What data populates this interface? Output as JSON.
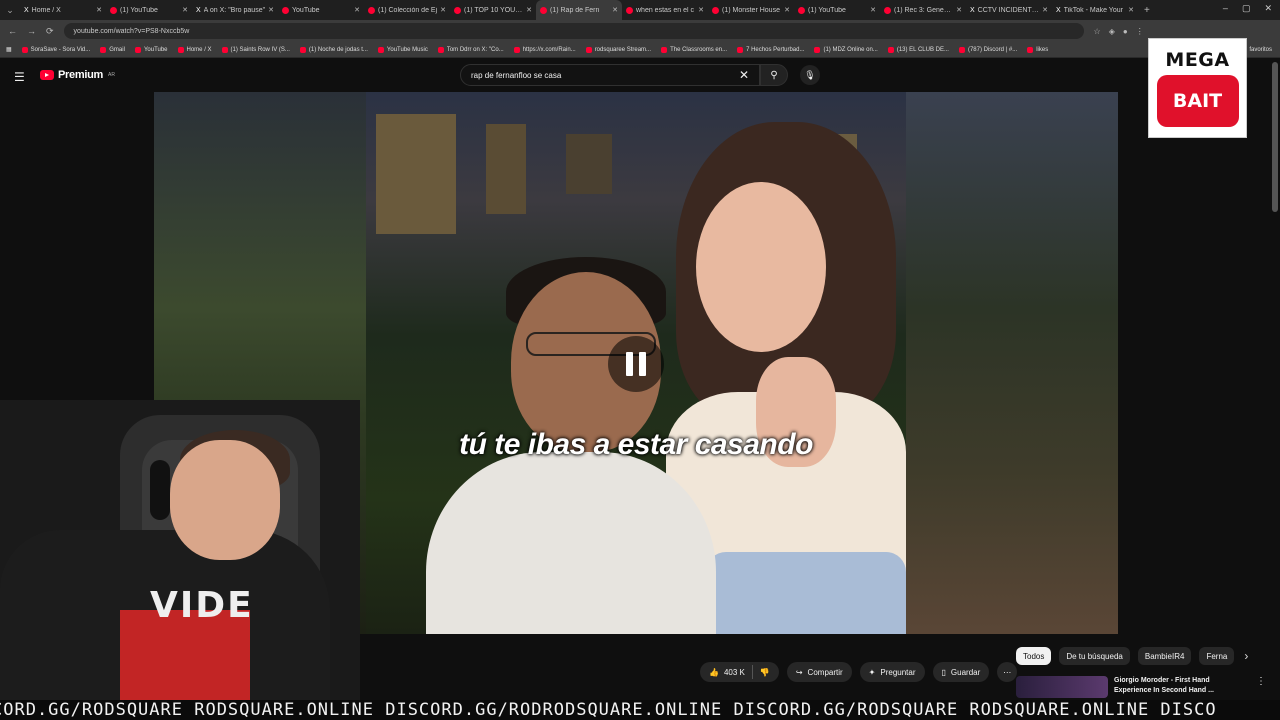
{
  "tabs": [
    {
      "title": "Home / X",
      "icon": "x"
    },
    {
      "title": "(1) YouTube",
      "icon": "yt"
    },
    {
      "title": "A on X: \"Bro pause\"",
      "icon": "x"
    },
    {
      "title": "YouTube",
      "icon": "yt"
    },
    {
      "title": "(1) Colección de Ej",
      "icon": "yt"
    },
    {
      "title": "(1) TOP 10 YOUTUB",
      "icon": "yt"
    },
    {
      "title": "(1) Rap de Fern",
      "icon": "yt",
      "active": true
    },
    {
      "title": "when estas en el c",
      "icon": "yt"
    },
    {
      "title": "(1) Monster House",
      "icon": "yt"
    },
    {
      "title": "(1) YouTube",
      "icon": "yt"
    },
    {
      "title": "(1) Rec 3: Genesis C",
      "icon": "yt"
    },
    {
      "title": "CCTV INCIDENTS (",
      "icon": "x"
    },
    {
      "title": "TikTok - Make Your",
      "icon": "x"
    }
  ],
  "address": {
    "url": "youtube.com/watch?v=PS8-Nxccb5w"
  },
  "bookmarks": [
    "SoraSave - Sora Vid...",
    "Gmail",
    "YouTube",
    "Home / X",
    "(1) Saints Row IV (S...",
    "(1) Noche de jodas t...",
    "YouTube Music",
    "Tom Ddrr on X: \"Co...",
    "https://x.com/Rain...",
    "rodsquaree Stream...",
    "The Classrooms en...",
    "7 Hechos Perturbad...",
    "(1) MDZ Online on...",
    "(13) EL CLUB DE...",
    "(787) Discord | #...",
    "likes"
  ],
  "bookmarks_right": "favoritos",
  "yt": {
    "brand": "Premium",
    "region": "AR",
    "search_query": "rap de fernanfloo se casa"
  },
  "video": {
    "subtitle": "tú te ibas a estar casando"
  },
  "actions": {
    "likes": "403 K",
    "share": "Compartir",
    "ask": "Preguntar",
    "save": "Guardar"
  },
  "chips": [
    "Todos",
    "De tu búsqueda",
    "BambieIR4",
    "Ferna"
  ],
  "rec": {
    "title1": "Giorgio Moroder - First Hand",
    "title2": "Experience In Second Hand ..."
  },
  "overlay": {
    "line1": "MEGA",
    "line2": "BAIT"
  },
  "webcam": {
    "shirt_text": "VIDE"
  },
  "ticker": "CORD.GG/RODSQUARE RODSQUARE.ONLINE DISCORD.GG/RODRODSQUARE.ONLINE DISCORD.GG/RODSQUARE RODSQUARE.ONLINE DISCO",
  "colors": {
    "youtube_red": "#ff0033",
    "bait_red": "#e0112b",
    "bg": "#0f0f0f"
  }
}
